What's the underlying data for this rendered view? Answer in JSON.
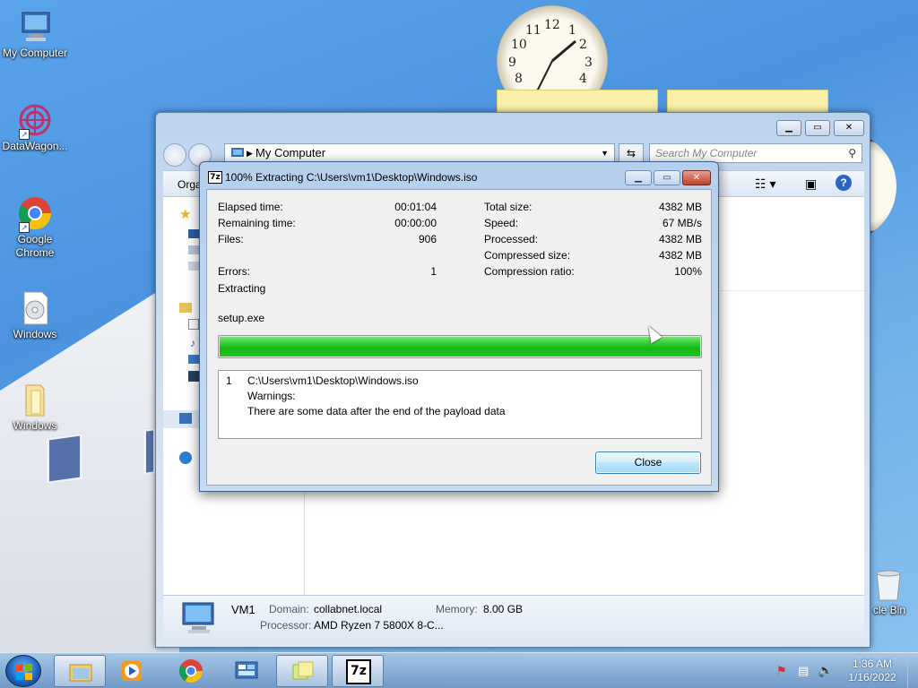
{
  "desktop": {
    "icons": [
      {
        "label": "My Computer"
      },
      {
        "label": "DataWagon..."
      },
      {
        "label": "Google Chrome"
      },
      {
        "label": "Windows"
      },
      {
        "label": "Windows"
      }
    ],
    "recycle_label": "cle Bin",
    "clock_numbers": [
      "12",
      "1",
      "2",
      "3",
      "4",
      "8",
      "9",
      "10",
      "11"
    ]
  },
  "explorer": {
    "address": "My Computer",
    "search_placeholder": "Search My Computer",
    "cmd_label": "Orga",
    "details": {
      "name": "VM1",
      "domain_label": "Domain:",
      "domain_value": "collabnet.local",
      "memory_label": "Memory:",
      "memory_value": "8.00 GB",
      "processor_label": "Processor:",
      "processor_value": "AMD Ryzen 7 5800X 8-C..."
    }
  },
  "dialog": {
    "title": "100% Extracting C:\\Users\\vm1\\Desktop\\Windows.iso",
    "icon_text": "7z",
    "stats_left": [
      {
        "label": "Elapsed time:",
        "value": "00:01:04"
      },
      {
        "label": "Remaining time:",
        "value": "00:00:00"
      },
      {
        "label": "Files:",
        "value": "906"
      },
      {
        "label": "Errors:",
        "value": "1"
      }
    ],
    "stats_right": [
      {
        "label": "Total size:",
        "value": "4382 MB"
      },
      {
        "label": "Speed:",
        "value": "67 MB/s"
      },
      {
        "label": "Processed:",
        "value": "4382 MB"
      },
      {
        "label": "Compressed size:",
        "value": "4382 MB"
      },
      {
        "label": "Compression ratio:",
        "value": "100%"
      }
    ],
    "status": "Extracting",
    "current_file": "setup.exe",
    "progress_percent": 100,
    "messages": {
      "index": "1",
      "path": "C:\\Users\\vm1\\Desktop\\Windows.iso",
      "warning_label": "Warnings:",
      "warning_text": "There are some data after the end of the payload data"
    },
    "close_label": "Close"
  },
  "taskbar": {
    "time": "1:36 AM",
    "date": "1/16/2022",
    "items": [
      "explorer",
      "media-player",
      "chrome",
      "control-panel",
      "sticky-notes",
      "7-zip"
    ],
    "sevenzip_text": "7z"
  }
}
